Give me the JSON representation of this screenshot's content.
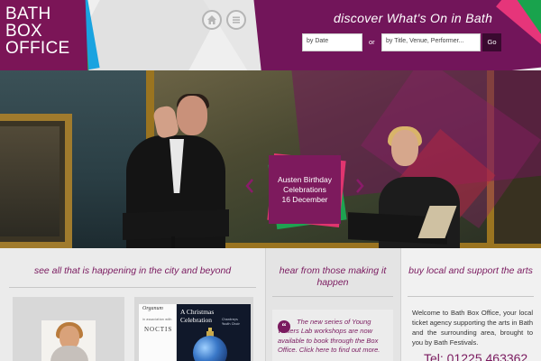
{
  "header": {
    "logo_lines": [
      "BATH",
      "BOX",
      "OFFICE"
    ],
    "home_icon": "home-icon",
    "menu_icon": "menu-icon",
    "discover_title": "discover What's On in Bath",
    "date_placeholder": "by Date",
    "or_label": "or",
    "search_placeholder": "by Title, Venue, Performer...",
    "go_label": "Go",
    "accent": "#72155a"
  },
  "hero": {
    "event_title": "Austen Birthday Celebrations",
    "event_date": "16 December",
    "prev_icon": "chevron-left-icon",
    "next_icon": "chevron-right-icon"
  },
  "sections": {
    "city_title": "see all that is happening in the city and beyond",
    "hear_title": "hear from those making it happen",
    "local_title": "buy local and support the arts"
  },
  "poster": {
    "logo": "Organum",
    "logo_sub": "in association with",
    "org": "NOCTIS",
    "title": "A Christmas Celebration",
    "sub": "Chantreys Youth Choir"
  },
  "quote": {
    "text": "The new series of Young Writers Lab workshops are now available to book through the Box Office. Click here to find out more."
  },
  "welcome": {
    "text": "Welcome to Bath Box Office, your local ticket agency supporting the arts in Bath and the surrounding area, brought to you by Bath Festivals.",
    "phone": "Tel: 01225 463362"
  }
}
